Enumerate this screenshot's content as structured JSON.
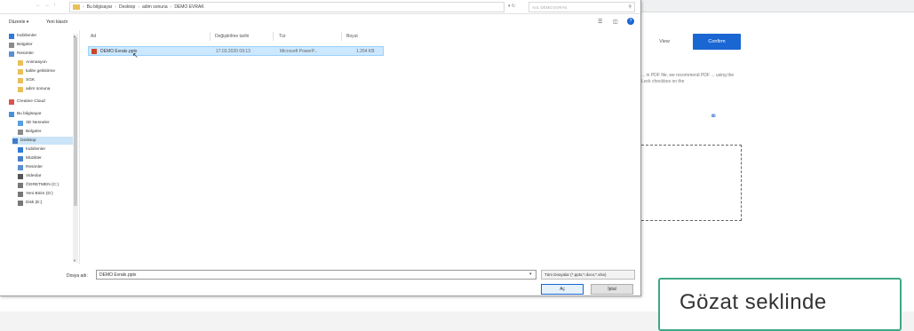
{
  "background": {
    "view_label": "View",
    "confirm_label": "Confirm",
    "paragraph": "... in PDF file, we recommend PDF ... using the Lock checkbox on the",
    "link_icon": "link-icon",
    "overlay_text": "Gözat seklinde",
    "colors": {
      "confirm": "#1a66d2",
      "overlay_border": "#3fa886"
    }
  },
  "dialog": {
    "addressbar": {
      "crumbs": [
        "Bu bilgisayar",
        "Desktop",
        "adim sonuna",
        "DEMO EVRAK"
      ],
      "search_placeholder": "Ara: DEMO EVRAK"
    },
    "toolbar": {
      "organize": "Düzenle ▾",
      "new_folder": "Yeni klasör"
    },
    "sidebar": {
      "items": [
        {
          "label": "İndirilenler",
          "icon": "download-icon",
          "indent": false
        },
        {
          "label": "Belgeler",
          "icon": "documents-icon",
          "indent": false
        },
        {
          "label": "Resimler",
          "icon": "pictures-icon",
          "indent": false
        },
        {
          "label": "Animasyon",
          "icon": "folder-icon",
          "indent": true
        },
        {
          "label": "kalite gelistirme",
          "icon": "folder-icon",
          "indent": true
        },
        {
          "label": "SGK",
          "icon": "folder-icon",
          "indent": true
        },
        {
          "label": "adim sonuna",
          "icon": "folder-icon",
          "indent": true
        },
        {
          "label": "Creative Cloud",
          "icon": "cloud-icon",
          "indent": false
        },
        {
          "label": "Bu bilgisayar",
          "icon": "computer-icon",
          "indent": false
        },
        {
          "label": "3D Nesneler",
          "icon": "cube-icon",
          "indent": true
        },
        {
          "label": "Belgeler",
          "icon": "documents-icon",
          "indent": true
        },
        {
          "label": "Desktop",
          "icon": "desktop-icon",
          "indent": true,
          "selected": true
        },
        {
          "label": "İndirilenler",
          "icon": "download-icon",
          "indent": true
        },
        {
          "label": "Müzikler",
          "icon": "music-icon",
          "indent": true
        },
        {
          "label": "Resimler",
          "icon": "pictures-icon",
          "indent": true
        },
        {
          "label": "Videolar",
          "icon": "video-icon",
          "indent": true
        },
        {
          "label": "ÖGRETMEN (C:)",
          "icon": "drive-icon",
          "indent": true
        },
        {
          "label": "Yeni Birim (D:)",
          "icon": "drive-icon",
          "indent": true
        },
        {
          "label": "Disk (E:)",
          "icon": "drive-icon",
          "indent": true
        }
      ]
    },
    "filelist": {
      "headers": {
        "name": "Ad",
        "date": "Değiştirilme tarihi",
        "type": "Tür",
        "size": "Boyut"
      },
      "rows": [
        {
          "name": "DEMO Evrakı.pptx",
          "date": "17.03.2020 09:13",
          "type": "Microsoft PowerP...",
          "size": "1.264 KB"
        }
      ]
    },
    "footer": {
      "filename_label": "Dosya adı:",
      "filename_value": "DEMO Evrakı.pptx",
      "filetype_value": "Tüm Dosyalar (*.pptx;*.docx;*.xlsx)",
      "open_label": "Aç",
      "cancel_label": "İptal"
    }
  }
}
